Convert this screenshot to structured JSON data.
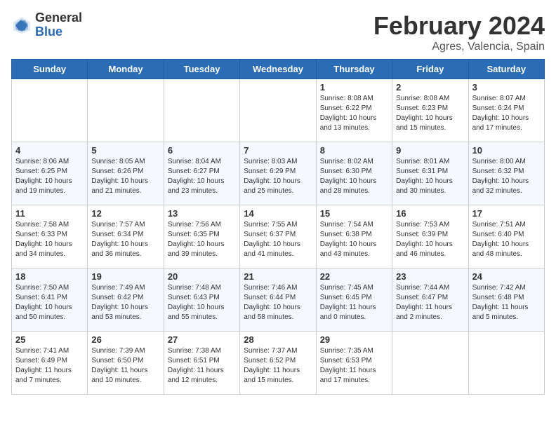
{
  "header": {
    "logo_general": "General",
    "logo_blue": "Blue",
    "month_title": "February 2024",
    "location": "Agres, Valencia, Spain"
  },
  "weekdays": [
    "Sunday",
    "Monday",
    "Tuesday",
    "Wednesday",
    "Thursday",
    "Friday",
    "Saturday"
  ],
  "weeks": [
    [
      {
        "day": "",
        "info": ""
      },
      {
        "day": "",
        "info": ""
      },
      {
        "day": "",
        "info": ""
      },
      {
        "day": "",
        "info": ""
      },
      {
        "day": "1",
        "info": "Sunrise: 8:08 AM\nSunset: 6:22 PM\nDaylight: 10 hours\nand 13 minutes."
      },
      {
        "day": "2",
        "info": "Sunrise: 8:08 AM\nSunset: 6:23 PM\nDaylight: 10 hours\nand 15 minutes."
      },
      {
        "day": "3",
        "info": "Sunrise: 8:07 AM\nSunset: 6:24 PM\nDaylight: 10 hours\nand 17 minutes."
      }
    ],
    [
      {
        "day": "4",
        "info": "Sunrise: 8:06 AM\nSunset: 6:25 PM\nDaylight: 10 hours\nand 19 minutes."
      },
      {
        "day": "5",
        "info": "Sunrise: 8:05 AM\nSunset: 6:26 PM\nDaylight: 10 hours\nand 21 minutes."
      },
      {
        "day": "6",
        "info": "Sunrise: 8:04 AM\nSunset: 6:27 PM\nDaylight: 10 hours\nand 23 minutes."
      },
      {
        "day": "7",
        "info": "Sunrise: 8:03 AM\nSunset: 6:29 PM\nDaylight: 10 hours\nand 25 minutes."
      },
      {
        "day": "8",
        "info": "Sunrise: 8:02 AM\nSunset: 6:30 PM\nDaylight: 10 hours\nand 28 minutes."
      },
      {
        "day": "9",
        "info": "Sunrise: 8:01 AM\nSunset: 6:31 PM\nDaylight: 10 hours\nand 30 minutes."
      },
      {
        "day": "10",
        "info": "Sunrise: 8:00 AM\nSunset: 6:32 PM\nDaylight: 10 hours\nand 32 minutes."
      }
    ],
    [
      {
        "day": "11",
        "info": "Sunrise: 7:58 AM\nSunset: 6:33 PM\nDaylight: 10 hours\nand 34 minutes."
      },
      {
        "day": "12",
        "info": "Sunrise: 7:57 AM\nSunset: 6:34 PM\nDaylight: 10 hours\nand 36 minutes."
      },
      {
        "day": "13",
        "info": "Sunrise: 7:56 AM\nSunset: 6:35 PM\nDaylight: 10 hours\nand 39 minutes."
      },
      {
        "day": "14",
        "info": "Sunrise: 7:55 AM\nSunset: 6:37 PM\nDaylight: 10 hours\nand 41 minutes."
      },
      {
        "day": "15",
        "info": "Sunrise: 7:54 AM\nSunset: 6:38 PM\nDaylight: 10 hours\nand 43 minutes."
      },
      {
        "day": "16",
        "info": "Sunrise: 7:53 AM\nSunset: 6:39 PM\nDaylight: 10 hours\nand 46 minutes."
      },
      {
        "day": "17",
        "info": "Sunrise: 7:51 AM\nSunset: 6:40 PM\nDaylight: 10 hours\nand 48 minutes."
      }
    ],
    [
      {
        "day": "18",
        "info": "Sunrise: 7:50 AM\nSunset: 6:41 PM\nDaylight: 10 hours\nand 50 minutes."
      },
      {
        "day": "19",
        "info": "Sunrise: 7:49 AM\nSunset: 6:42 PM\nDaylight: 10 hours\nand 53 minutes."
      },
      {
        "day": "20",
        "info": "Sunrise: 7:48 AM\nSunset: 6:43 PM\nDaylight: 10 hours\nand 55 minutes."
      },
      {
        "day": "21",
        "info": "Sunrise: 7:46 AM\nSunset: 6:44 PM\nDaylight: 10 hours\nand 58 minutes."
      },
      {
        "day": "22",
        "info": "Sunrise: 7:45 AM\nSunset: 6:45 PM\nDaylight: 11 hours\nand 0 minutes."
      },
      {
        "day": "23",
        "info": "Sunrise: 7:44 AM\nSunset: 6:47 PM\nDaylight: 11 hours\nand 2 minutes."
      },
      {
        "day": "24",
        "info": "Sunrise: 7:42 AM\nSunset: 6:48 PM\nDaylight: 11 hours\nand 5 minutes."
      }
    ],
    [
      {
        "day": "25",
        "info": "Sunrise: 7:41 AM\nSunset: 6:49 PM\nDaylight: 11 hours\nand 7 minutes."
      },
      {
        "day": "26",
        "info": "Sunrise: 7:39 AM\nSunset: 6:50 PM\nDaylight: 11 hours\nand 10 minutes."
      },
      {
        "day": "27",
        "info": "Sunrise: 7:38 AM\nSunset: 6:51 PM\nDaylight: 11 hours\nand 12 minutes."
      },
      {
        "day": "28",
        "info": "Sunrise: 7:37 AM\nSunset: 6:52 PM\nDaylight: 11 hours\nand 15 minutes."
      },
      {
        "day": "29",
        "info": "Sunrise: 7:35 AM\nSunset: 6:53 PM\nDaylight: 11 hours\nand 17 minutes."
      },
      {
        "day": "",
        "info": ""
      },
      {
        "day": "",
        "info": ""
      }
    ]
  ]
}
